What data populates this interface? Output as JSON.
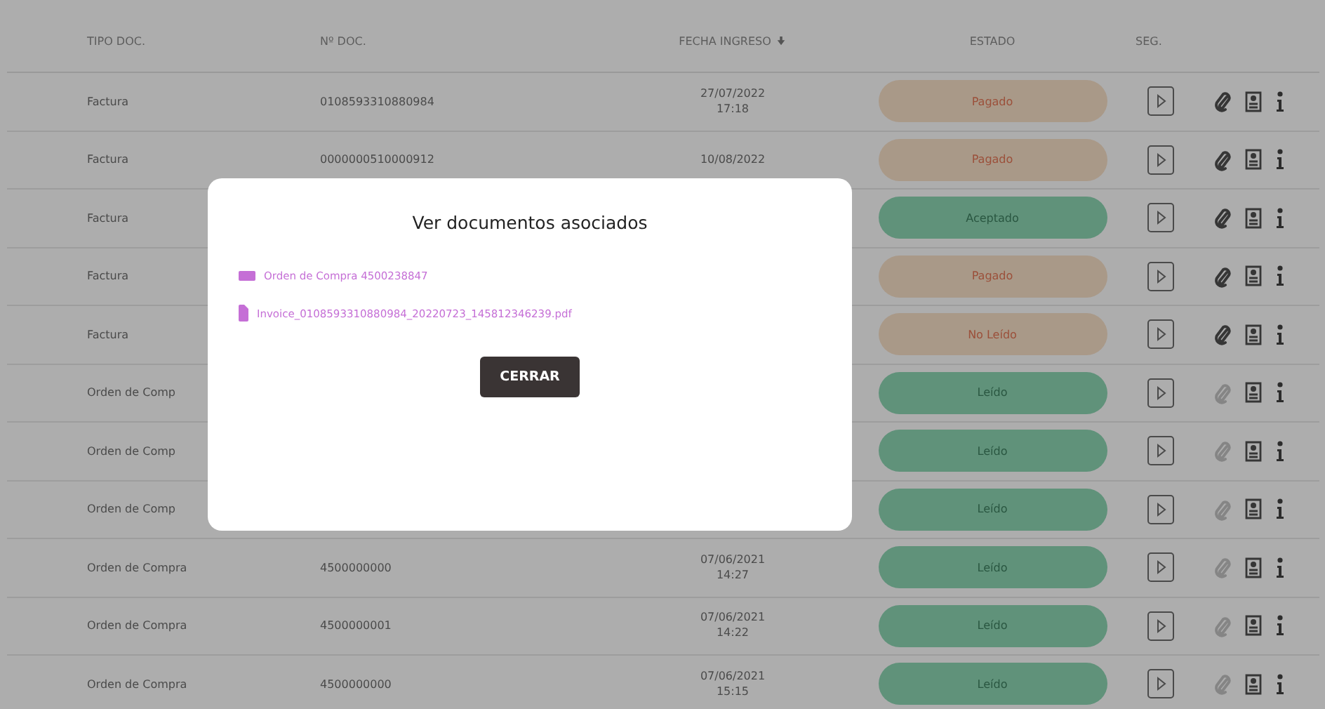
{
  "table": {
    "columns": [
      {
        "label": "TIPO DOC."
      },
      {
        "label": "Nº DOC."
      },
      {
        "label": "FECHA INGRESO",
        "sorted": true
      },
      {
        "label": "ESTADO"
      },
      {
        "label": "SEG."
      }
    ],
    "rows": [
      {
        "tipo": "Factura",
        "numero": "0108593310880984",
        "fecha": "27/07/2022",
        "hora": "17:18",
        "estado": "Pagado",
        "kind": "warning",
        "adjuntos": true
      },
      {
        "tipo": "Factura",
        "numero": "0000000510000912",
        "fecha": "10/08/2022",
        "estado": "Pagado",
        "kind": "warning",
        "adjuntos": true
      },
      {
        "tipo": "Factura",
        "estado": "Aceptado",
        "kind": "success",
        "adjuntos": true
      },
      {
        "tipo": "Factura",
        "estado": "Pagado",
        "kind": "warning",
        "adjuntos": true
      },
      {
        "tipo": "Factura",
        "estado": "No Leído",
        "kind": "warning",
        "adjuntos": true
      },
      {
        "tipo": "Orden de Comp",
        "estado": "Leído",
        "kind": "success",
        "adjuntos": false
      },
      {
        "tipo": "Orden de Comp",
        "estado": "Leído",
        "kind": "success",
        "adjuntos": false
      },
      {
        "tipo": "Orden de Comp",
        "estado": "Leído",
        "kind": "success",
        "adjuntos": false
      },
      {
        "tipo": "Orden de Compra",
        "numero": "4500000000",
        "fecha": "07/06/2021",
        "hora": "14:27",
        "estado": "Leído",
        "kind": "success",
        "adjuntos": false
      },
      {
        "tipo": "Orden de Compra",
        "numero": "4500000001",
        "fecha": "07/06/2021",
        "hora": "14:22",
        "estado": "Leído",
        "kind": "success",
        "adjuntos": false
      },
      {
        "tipo": "Orden de Compra",
        "numero": "4500000000",
        "fecha": "07/06/2021",
        "hora": "15:15",
        "estado": "Leído",
        "kind": "success",
        "adjuntos": false
      }
    ]
  },
  "modal": {
    "title": "Ver documentos asociados",
    "documents": [
      {
        "kind": "order",
        "label": "Orden de Compra 4500238847"
      },
      {
        "kind": "file",
        "label": "Invoice_0108593310880984_20220723_145812346239.pdf"
      }
    ],
    "close_button": "CERRAR"
  }
}
